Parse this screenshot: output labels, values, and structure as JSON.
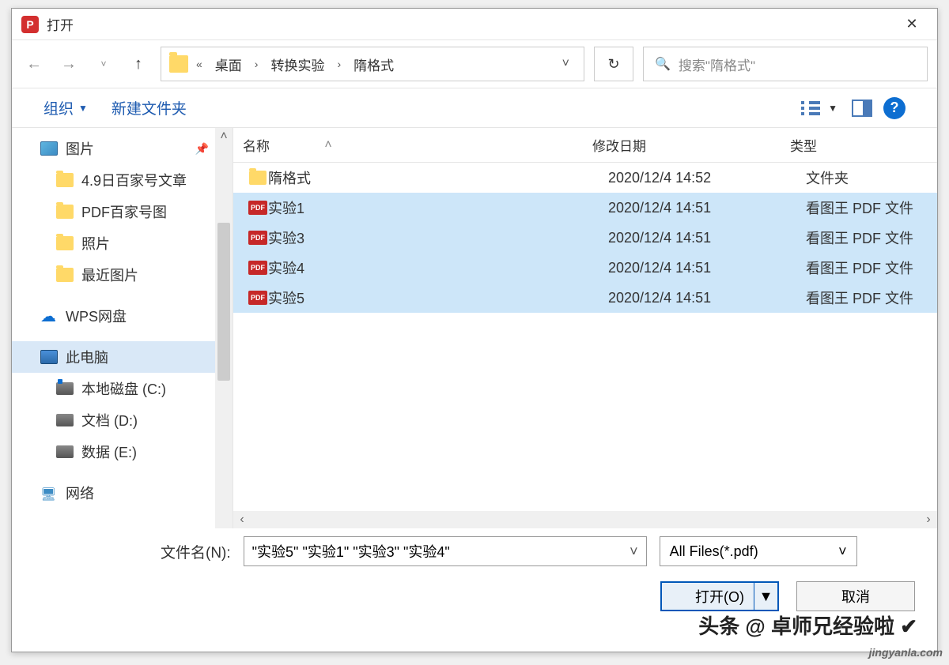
{
  "title": "打开",
  "breadcrumb": {
    "prefix": "«",
    "parts": [
      "桌面",
      "转换实验",
      "隋格式"
    ]
  },
  "refresh_icon": "↻",
  "search": {
    "placeholder": "搜索\"隋格式\""
  },
  "toolbar": {
    "organize": "组织",
    "new_folder": "新建文件夹"
  },
  "sidebar": {
    "pictures": "图片",
    "quick": [
      "4.9日百家号文章",
      "PDF百家号图",
      "照片",
      "最近图片"
    ],
    "wps": "WPS网盘",
    "this_pc": "此电脑",
    "drives": [
      "本地磁盘 (C:)",
      "文档 (D:)",
      "数据 (E:)"
    ],
    "network": "网络"
  },
  "columns": {
    "name": "名称",
    "date": "修改日期",
    "type": "类型"
  },
  "files": [
    {
      "icon": "folder",
      "name": "隋格式",
      "date": "2020/12/4 14:52",
      "type": "文件夹",
      "selected": false
    },
    {
      "icon": "pdf",
      "name": "实验1",
      "date": "2020/12/4 14:51",
      "type": "看图王 PDF 文件",
      "selected": true
    },
    {
      "icon": "pdf",
      "name": "实验3",
      "date": "2020/12/4 14:51",
      "type": "看图王 PDF 文件",
      "selected": true
    },
    {
      "icon": "pdf",
      "name": "实验4",
      "date": "2020/12/4 14:51",
      "type": "看图王 PDF 文件",
      "selected": true
    },
    {
      "icon": "pdf",
      "name": "实验5",
      "date": "2020/12/4 14:51",
      "type": "看图王 PDF 文件",
      "selected": true
    }
  ],
  "filename": {
    "label": "文件名(N):",
    "value": "\"实验5\" \"实验1\" \"实验3\" \"实验4\""
  },
  "filter": "All Files(*.pdf)",
  "actions": {
    "open": "打开(O)",
    "cancel": "取消"
  },
  "watermarks": {
    "w1": "头条 @ 卓师兄经验啦 ✔",
    "w2": "jingyanla.com"
  }
}
